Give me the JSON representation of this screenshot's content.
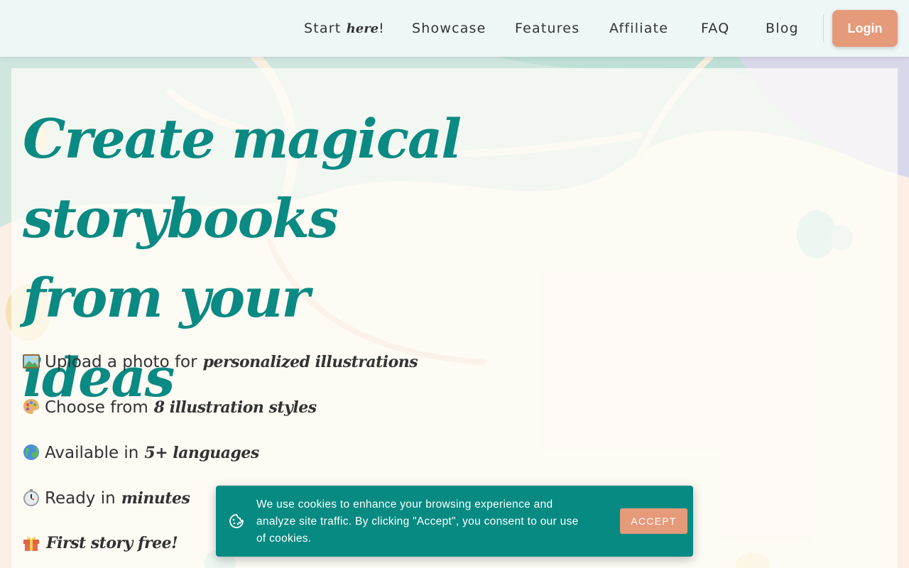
{
  "nav": {
    "items": [
      {
        "prefix": "Start ",
        "emphasis": "here",
        "suffix": "!"
      },
      {
        "label": "Showcase"
      },
      {
        "label": "Features"
      },
      {
        "label": "Affiliate"
      },
      {
        "label": "FAQ"
      },
      {
        "label": "Blog"
      }
    ],
    "login_label": "Login"
  },
  "hero": {
    "title": "Create magical storybooks from your ideas",
    "features": [
      {
        "icon": "framed-picture-icon",
        "text": "Upload a photo for",
        "emphasis": "personalized illustrations"
      },
      {
        "icon": "artist-palette-icon",
        "text": "Choose from",
        "emphasis": "8 illustration styles"
      },
      {
        "icon": "globe-icon",
        "text": "Available in",
        "emphasis": "5+ languages"
      },
      {
        "icon": "stopwatch-icon",
        "text": "Ready in",
        "emphasis": "minutes"
      },
      {
        "icon": "gift-icon",
        "text": "",
        "emphasis": "First story free!"
      }
    ]
  },
  "cookie": {
    "text": "We use cookies to enhance your browsing experience and analyze site traffic. By clicking \"Accept\", you consent to our use of cookies.",
    "accept_label": "ACCEPT",
    "icon": "cookie-icon"
  },
  "colors": {
    "brand_teal": "#0a8a82",
    "accent_peach": "#e59a7a",
    "nav_bg": "#eef6f7",
    "page_bg": "#fbefe6"
  }
}
